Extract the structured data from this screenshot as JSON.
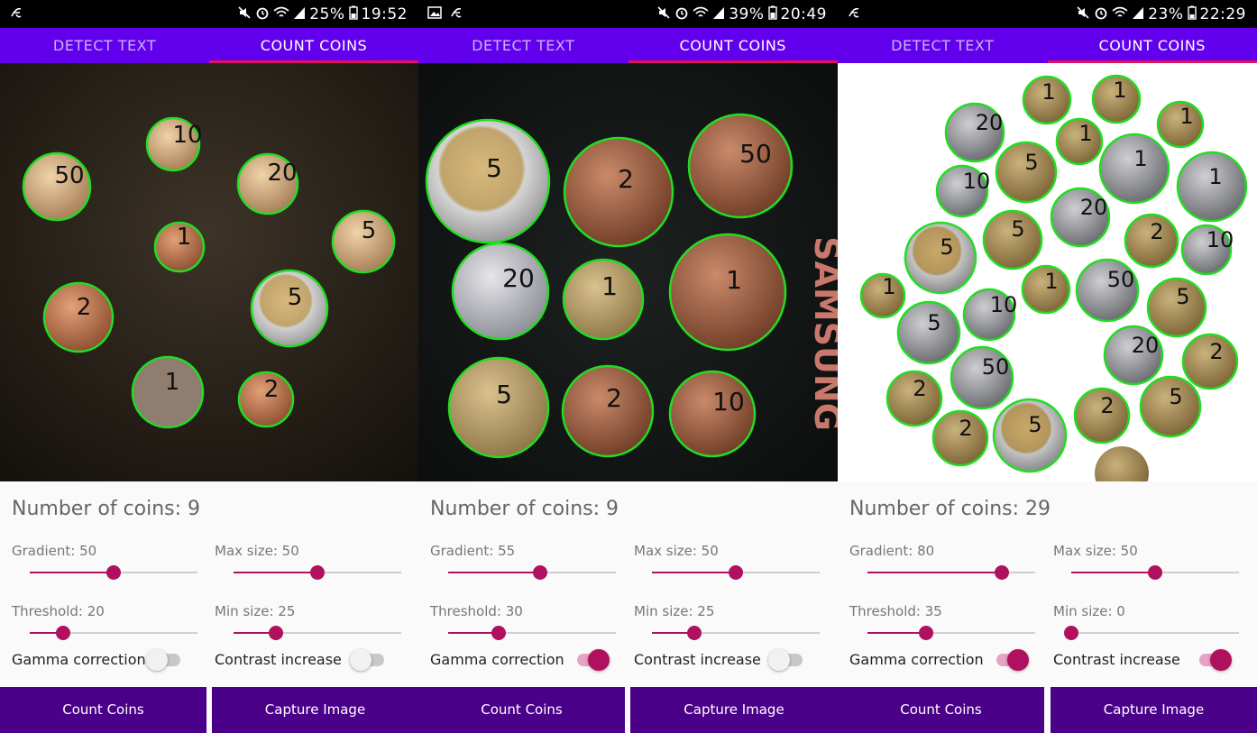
{
  "colors": {
    "tab_bar": "#6200ee",
    "tab_indicator": "#e0115f",
    "accent": "#b0115e",
    "button": "#4b008a",
    "coin_outline": "#22dd22"
  },
  "screens": [
    {
      "status": {
        "battery": "25%",
        "time": "19:52",
        "icons": [
          "app-icon",
          "mute-icon",
          "alarm-icon",
          "wifi-icon",
          "signal-icon",
          "battery-icon"
        ]
      },
      "tabs": [
        "DETECT TEXT",
        "COUNT COINS"
      ],
      "active_tab": 1,
      "coin_count_label": "Number of coins: 9",
      "coin_labels": [
        "10",
        "50",
        "20",
        "1",
        "5",
        "2",
        "5",
        "1",
        "2"
      ],
      "gradient": {
        "label": "Gradient: 50",
        "value": 50,
        "max": 100
      },
      "max_size": {
        "label": "Max size: 50",
        "value": 50,
        "max": 100
      },
      "threshold": {
        "label": "Threshold: 20",
        "value": 20,
        "max": 100
      },
      "min_size": {
        "label": "Min size: 25",
        "value": 25,
        "max": 100
      },
      "gamma_correction": {
        "label": "Gamma correction",
        "on": false
      },
      "contrast_increase": {
        "label": "Contrast increase",
        "on": false
      },
      "count_button": "Count Coins",
      "capture_button": "Capture Image"
    },
    {
      "status": {
        "battery": "39%",
        "time": "20:49",
        "icons": [
          "image-icon",
          "app-icon",
          "mute-icon",
          "alarm-icon",
          "wifi-icon",
          "signal-icon",
          "battery-icon"
        ]
      },
      "tabs": [
        "DETECT TEXT",
        "COUNT COINS"
      ],
      "active_tab": 1,
      "coin_count_label": "Number of coins: 9",
      "coin_labels": [
        "5",
        "2",
        "50",
        "20",
        "1",
        "1",
        "5",
        "2",
        "10"
      ],
      "background_text": "SAMSUNG",
      "gradient": {
        "label": "Gradient: 55",
        "value": 55,
        "max": 100
      },
      "max_size": {
        "label": "Max size: 50",
        "value": 50,
        "max": 100
      },
      "threshold": {
        "label": "Threshold: 30",
        "value": 30,
        "max": 100
      },
      "min_size": {
        "label": "Min size: 25",
        "value": 25,
        "max": 100
      },
      "gamma_correction": {
        "label": "Gamma correction",
        "on": true
      },
      "contrast_increase": {
        "label": "Contrast increase",
        "on": false
      },
      "count_button": "Count Coins",
      "capture_button": "Capture Image"
    },
    {
      "status": {
        "battery": "23%",
        "time": "22:29",
        "icons": [
          "app-icon",
          "mute-icon",
          "alarm-icon",
          "wifi-icon",
          "signal-icon",
          "battery-icon"
        ]
      },
      "tabs": [
        "DETECT TEXT",
        "COUNT COINS"
      ],
      "active_tab": 1,
      "coin_count_label": "Number of coins: 29",
      "coin_labels": [
        "1",
        "1",
        "20",
        "1",
        "1",
        "5",
        "1",
        "1",
        "10",
        "20",
        "5",
        "2",
        "10",
        "5",
        "1",
        "50",
        "5",
        "10",
        "1",
        "5",
        "50",
        "20",
        "2",
        "2",
        "2",
        "5",
        "5",
        "2"
      ],
      "gradient": {
        "label": "Gradient: 80",
        "value": 80,
        "max": 100
      },
      "max_size": {
        "label": "Max size: 50",
        "value": 50,
        "max": 100
      },
      "threshold": {
        "label": "Threshold: 35",
        "value": 35,
        "max": 100
      },
      "min_size": {
        "label": "Min size: 0",
        "value": 0,
        "max": 100
      },
      "gamma_correction": {
        "label": "Gamma correction",
        "on": true
      },
      "contrast_increase": {
        "label": "Contrast increase",
        "on": true
      },
      "count_button": "Count Coins",
      "capture_button": "Capture Image"
    }
  ]
}
